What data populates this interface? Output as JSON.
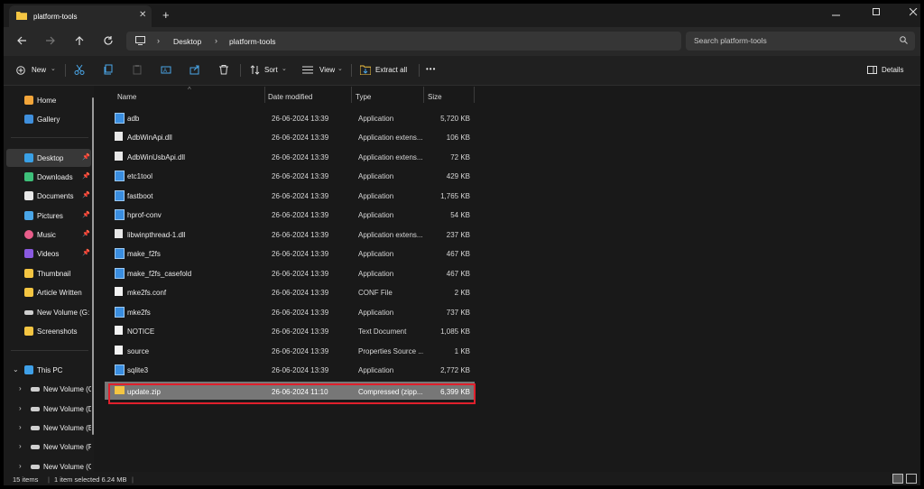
{
  "window": {
    "tab_title": "platform-tools",
    "new_tab": "+",
    "close_tab": "✕"
  },
  "address": {
    "crumbs": [
      "Desktop",
      "platform-tools"
    ],
    "search_placeholder": "Search platform-tools"
  },
  "toolbar": {
    "new_label": "New",
    "sort_label": "Sort",
    "view_label": "View",
    "extract_label": "Extract all",
    "more_label": "•••",
    "details_label": "Details"
  },
  "sidebar": {
    "top": [
      {
        "label": "Home",
        "icon": "home-icon",
        "color": "#f2a53a"
      },
      {
        "label": "Gallery",
        "icon": "gallery-icon",
        "color": "#3f8fdc"
      }
    ],
    "pinned": [
      {
        "label": "Desktop",
        "icon": "desktop-folder-icon",
        "color": "#39a0e6",
        "selected": true
      },
      {
        "label": "Downloads",
        "icon": "download-icon",
        "color": "#3ec07a"
      },
      {
        "label": "Documents",
        "icon": "document-icon",
        "color": "#e8e8e8"
      },
      {
        "label": "Pictures",
        "icon": "pictures-icon",
        "color": "#4aa6e8"
      },
      {
        "label": "Music",
        "icon": "music-icon",
        "color": "#e85d8a"
      },
      {
        "label": "Videos",
        "icon": "videos-icon",
        "color": "#8a5ae0"
      },
      {
        "label": "Thumbnail",
        "icon": "folder-icon",
        "color": "#f4c542"
      },
      {
        "label": "Article Written",
        "icon": "folder-icon",
        "color": "#f4c542"
      },
      {
        "label": "New Volume (G:",
        "icon": "drive-icon",
        "color": "#cfcfcf"
      },
      {
        "label": "Screenshots",
        "icon": "folder-icon",
        "color": "#f4c542"
      }
    ],
    "this_pc": {
      "label": "This PC",
      "icon": "this-pc-icon",
      "color": "#3fa0e8"
    },
    "drives": [
      {
        "label": "New Volume (C"
      },
      {
        "label": "New Volume (D"
      },
      {
        "label": "New Volume (E"
      },
      {
        "label": "New Volume (F"
      },
      {
        "label": "New Volume (G"
      }
    ]
  },
  "columns": {
    "name": "Name",
    "date": "Date modified",
    "type": "Type",
    "size": "Size"
  },
  "files": [
    {
      "name": "adb",
      "date": "26-06-2024 13:39",
      "type": "Application",
      "size": "5,720 KB",
      "icon": "application-icon"
    },
    {
      "name": "AdbWinApi.dll",
      "date": "26-06-2024 13:39",
      "type": "Application extens...",
      "size": "106 KB",
      "icon": "dll-icon"
    },
    {
      "name": "AdbWinUsbApi.dll",
      "date": "26-06-2024 13:39",
      "type": "Application extens...",
      "size": "72 KB",
      "icon": "dll-icon"
    },
    {
      "name": "etc1tool",
      "date": "26-06-2024 13:39",
      "type": "Application",
      "size": "429 KB",
      "icon": "application-icon"
    },
    {
      "name": "fastboot",
      "date": "26-06-2024 13:39",
      "type": "Application",
      "size": "1,765 KB",
      "icon": "application-icon"
    },
    {
      "name": "hprof-conv",
      "date": "26-06-2024 13:39",
      "type": "Application",
      "size": "54 KB",
      "icon": "application-icon"
    },
    {
      "name": "libwinpthread-1.dll",
      "date": "26-06-2024 13:39",
      "type": "Application extens...",
      "size": "237 KB",
      "icon": "dll-icon"
    },
    {
      "name": "make_f2fs",
      "date": "26-06-2024 13:39",
      "type": "Application",
      "size": "467 KB",
      "icon": "application-icon"
    },
    {
      "name": "make_f2fs_casefold",
      "date": "26-06-2024 13:39",
      "type": "Application",
      "size": "467 KB",
      "icon": "application-icon"
    },
    {
      "name": "mke2fs.conf",
      "date": "26-06-2024 13:39",
      "type": "CONF File",
      "size": "2 KB",
      "icon": "file-icon"
    },
    {
      "name": "mke2fs",
      "date": "26-06-2024 13:39",
      "type": "Application",
      "size": "737 KB",
      "icon": "application-icon"
    },
    {
      "name": "NOTICE",
      "date": "26-06-2024 13:39",
      "type": "Text Document",
      "size": "1,085 KB",
      "icon": "file-icon"
    },
    {
      "name": "source",
      "date": "26-06-2024 13:39",
      "type": "Properties Source ...",
      "size": "1 KB",
      "icon": "file-icon"
    },
    {
      "name": "sqlite3",
      "date": "26-06-2024 13:39",
      "type": "Application",
      "size": "2,772 KB",
      "icon": "application-icon"
    },
    {
      "name": "update.zip",
      "date": "26-06-2024 11:10",
      "type": "Compressed (zipp...",
      "size": "6,399 KB",
      "icon": "zip-folder-icon",
      "selected": true
    }
  ],
  "status": {
    "count": "15 items",
    "selection": "1 item selected  6.24 MB"
  },
  "colors": {
    "accent_highlight": "#e0202c",
    "selected_row": "#777777"
  }
}
